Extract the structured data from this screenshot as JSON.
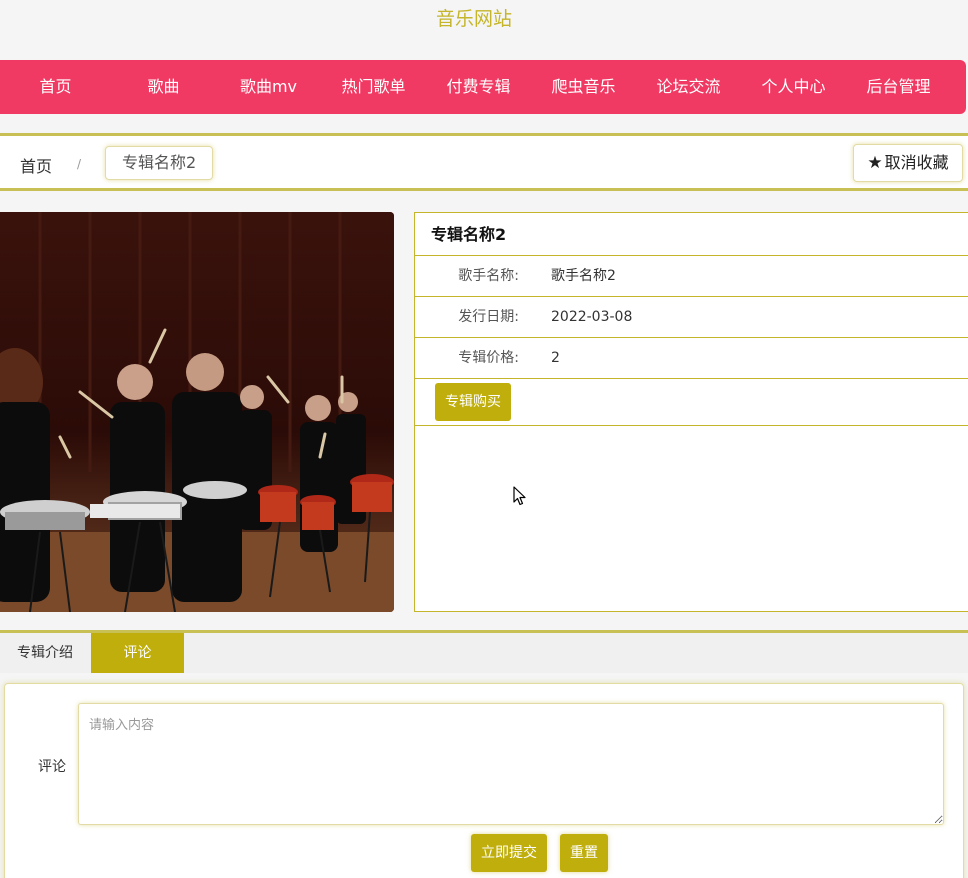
{
  "site": {
    "title": "音乐网站"
  },
  "nav": {
    "items": [
      "首页",
      "歌曲",
      "歌曲mv",
      "热门歌单",
      "付费专辑",
      "爬虫音乐",
      "论坛交流",
      "个人中心",
      "后台管理"
    ]
  },
  "breadcrumb": {
    "home": "首页",
    "separator": "/",
    "current": "专辑名称2"
  },
  "favorite": {
    "label": "取消收藏",
    "icon": "star-icon"
  },
  "album": {
    "name": "专辑名称2",
    "rows": [
      {
        "label": "歌手名称:",
        "value": "歌手名称2"
      },
      {
        "label": "发行日期:",
        "value": "2022-03-08"
      },
      {
        "label": "专辑价格:",
        "value": "2"
      }
    ],
    "buy_label": "专辑购买"
  },
  "tabs": {
    "intro": "专辑介绍",
    "comment": "评论",
    "active": "评论"
  },
  "comment_form": {
    "label": "评论",
    "placeholder": "请输入内容",
    "submit_label": "立即提交",
    "reset_label": "重置"
  },
  "colors": {
    "accent": "#bfae0b",
    "nav_bg": "#f03a63",
    "title": "#c4b52a"
  }
}
